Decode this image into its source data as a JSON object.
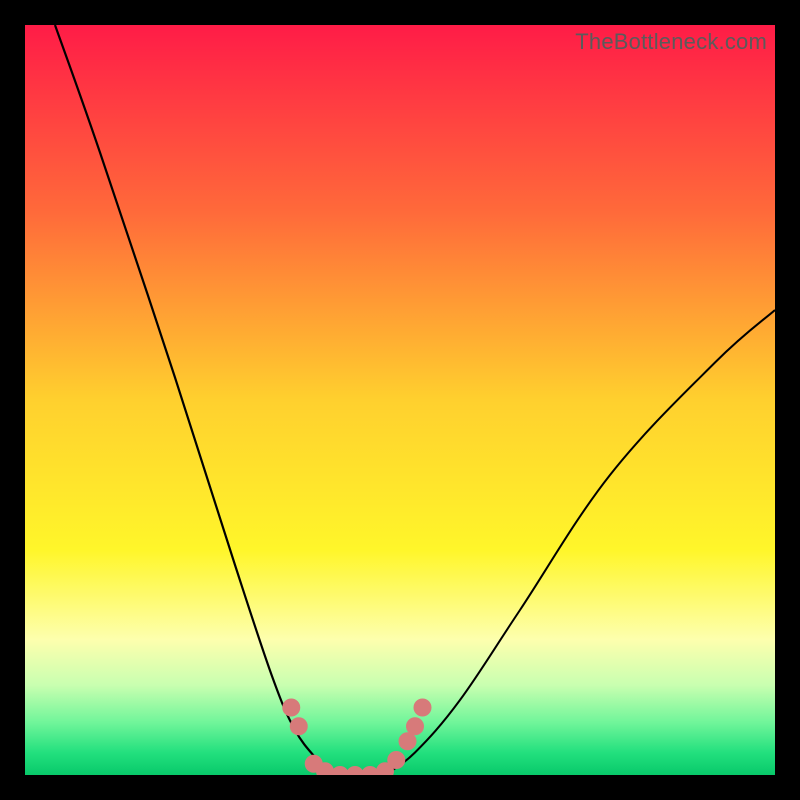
{
  "watermark": "TheBottleneck.com",
  "chart_data": {
    "type": "line",
    "title": "",
    "xlabel": "",
    "ylabel": "",
    "xlim": [
      0,
      100
    ],
    "ylim": [
      0,
      100
    ],
    "series": [
      {
        "name": "curve-left",
        "x": [
          4,
          10,
          20,
          28,
          33,
          36,
          39,
          41
        ],
        "y": [
          100,
          83,
          53,
          28,
          13,
          6,
          2,
          0
        ]
      },
      {
        "name": "curve-right",
        "x": [
          48,
          52,
          58,
          66,
          78,
          92,
          100
        ],
        "y": [
          0,
          3,
          10,
          22,
          40,
          55,
          62
        ]
      }
    ],
    "markers": {
      "name": "salmon-dots",
      "color": "#d77a7a",
      "points": [
        {
          "x": 35.5,
          "y": 9
        },
        {
          "x": 36.5,
          "y": 6.5
        },
        {
          "x": 38.5,
          "y": 1.5
        },
        {
          "x": 40,
          "y": 0.5
        },
        {
          "x": 42,
          "y": 0
        },
        {
          "x": 44,
          "y": 0
        },
        {
          "x": 46,
          "y": 0
        },
        {
          "x": 48,
          "y": 0.5
        },
        {
          "x": 49.5,
          "y": 2
        },
        {
          "x": 51,
          "y": 4.5
        },
        {
          "x": 52,
          "y": 6.5
        },
        {
          "x": 53,
          "y": 9
        }
      ]
    },
    "gradient_stops": [
      {
        "offset": 0.0,
        "color": "#ff1c47"
      },
      {
        "offset": 0.25,
        "color": "#ff6a3a"
      },
      {
        "offset": 0.5,
        "color": "#ffd02e"
      },
      {
        "offset": 0.7,
        "color": "#fff62a"
      },
      {
        "offset": 0.82,
        "color": "#fdffae"
      },
      {
        "offset": 0.88,
        "color": "#c9ffb0"
      },
      {
        "offset": 0.93,
        "color": "#70f59a"
      },
      {
        "offset": 0.97,
        "color": "#23e07e"
      },
      {
        "offset": 1.0,
        "color": "#08c96a"
      }
    ]
  }
}
